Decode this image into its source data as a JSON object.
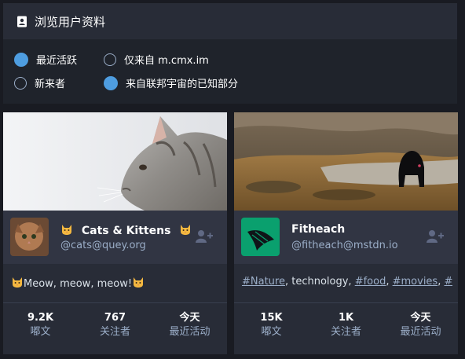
{
  "header": {
    "title": "浏览用户资料"
  },
  "filters": {
    "options": [
      {
        "label": "最近活跃",
        "checked": true
      },
      {
        "label": "仅来自 m.cmx.im",
        "checked": false
      },
      {
        "label": "新来者",
        "checked": false
      },
      {
        "label": "来自联邦宇宙的已知部分",
        "checked": true
      }
    ]
  },
  "cards": [
    {
      "display_name": "Cats & Kittens",
      "acct": "@cats@quey.org",
      "bio": "Meow, meow, meow!",
      "stats": [
        {
          "value": "9.2K",
          "label": "嘟文"
        },
        {
          "value": "767",
          "label": "关注者"
        },
        {
          "value": "今天",
          "label": "最近活动"
        }
      ]
    },
    {
      "display_name": "Fitheach",
      "acct": "@fitheach@mstdn.io",
      "bio_parts": [
        {
          "text": "#Nature",
          "tag": true
        },
        {
          "text": ", technology, ",
          "tag": false
        },
        {
          "text": "#food",
          "tag": true
        },
        {
          "text": ", ",
          "tag": false
        },
        {
          "text": "#movies",
          "tag": true
        },
        {
          "text": ", ",
          "tag": false
        },
        {
          "text": "#...",
          "tag": true
        }
      ],
      "stats": [
        {
          "value": "15K",
          "label": "嘟文"
        },
        {
          "value": "1K",
          "label": "关注者"
        },
        {
          "value": "今天",
          "label": "最近活动"
        }
      ]
    }
  ],
  "colors": {
    "background": "#191b22",
    "panel": "#282c37",
    "accent": "#4e9de0",
    "muted_text": "#9baec8"
  }
}
